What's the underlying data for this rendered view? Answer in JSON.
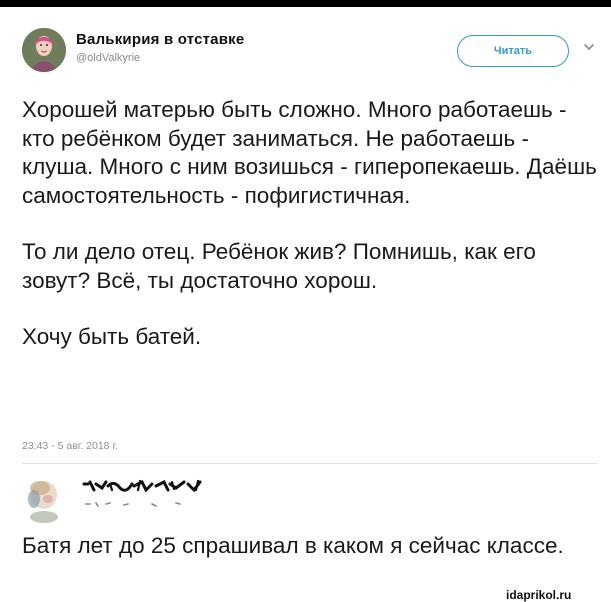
{
  "tweet": {
    "author": {
      "display_name": "Валькирия в отставке",
      "handle": "@oldValkyrie",
      "avatar_icon": "user-avatar-photo"
    },
    "follow_button_label": "Читать",
    "menu_icon": "chevron-down-icon",
    "paragraphs": [
      "Хорошей матерью быть сложно. Много работаешь - кто ребёнком будет заниматься. Не работаешь - клуша. Много с ним возишься - гиперопекаешь. Даёшь самостоятельность - пофигистичная.",
      "То ли дело отец. Ребёнок жив? Помнишь, как его зовут? Всё, ты достаточно хорош.",
      "Хочу быть батей."
    ],
    "timestamp": "23:43 - 5 авг. 2018 г."
  },
  "reply": {
    "avatar_icon": "blurred-avatar-photo",
    "name_icon": "scribbled-out-username",
    "text": "Батя лет до 25 спрашивал в каком я сейчас классе."
  },
  "watermark": "idaprikol.ru",
  "colors": {
    "accent": "#2d9cdb",
    "text": "#1a1a1a",
    "muted": "#8a8a8a"
  }
}
